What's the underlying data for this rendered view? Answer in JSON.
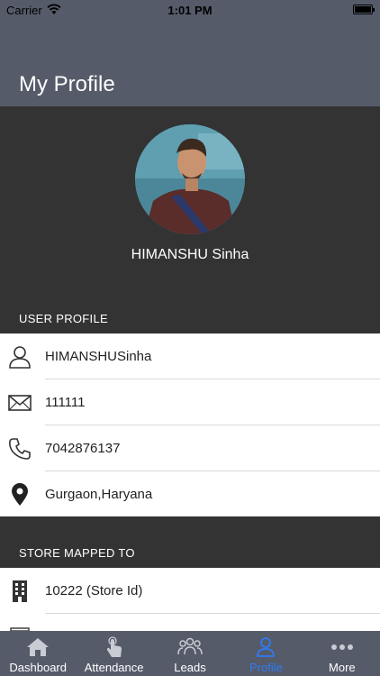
{
  "status_bar": {
    "carrier": "Carrier",
    "time": "1:01 PM"
  },
  "header": {
    "title": "My Profile"
  },
  "profile": {
    "name": "HIMANSHU Sinha"
  },
  "user_profile": {
    "heading": "USER PROFILE",
    "rows": [
      {
        "icon": "person-icon",
        "text": "HIMANSHUSinha"
      },
      {
        "icon": "mail-icon",
        "text": "111111"
      },
      {
        "icon": "phone-icon",
        "text": "7042876137"
      },
      {
        "icon": "location-pin-icon",
        "text": "Gurgaon,Haryana"
      }
    ]
  },
  "store_mapped": {
    "heading": "STORE MAPPED TO",
    "rows": [
      {
        "icon": "building-icon",
        "text": "10222 (Store Id)"
      }
    ]
  },
  "tabs": [
    {
      "icon": "home-icon",
      "label": "Dashboard",
      "active": false
    },
    {
      "icon": "touch-hand-icon",
      "label": "Attendance",
      "active": false
    },
    {
      "icon": "group-icon",
      "label": "Leads",
      "active": false
    },
    {
      "icon": "person-icon",
      "label": "Profile",
      "active": true
    },
    {
      "icon": "more-dots-icon",
      "label": "More",
      "active": false
    }
  ],
  "colors": {
    "header": "#555b69",
    "background": "#333333",
    "active_tab": "#2f7bf5"
  }
}
